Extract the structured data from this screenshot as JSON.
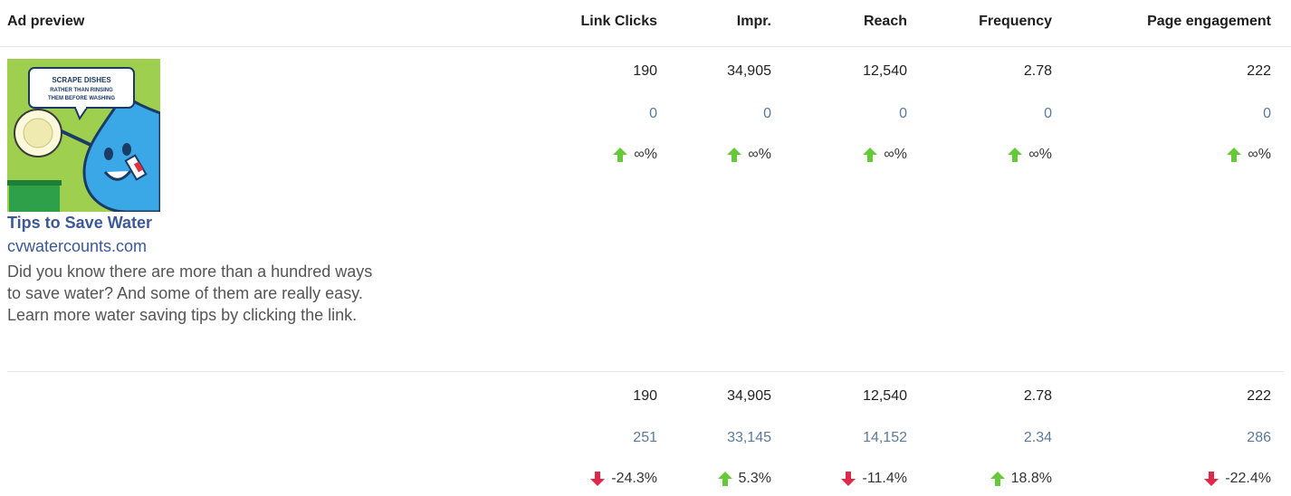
{
  "header": {
    "ad_preview": "Ad preview",
    "columns": [
      "Link Clicks",
      "Impr.",
      "Reach",
      "Frequency",
      "Page engagement"
    ]
  },
  "ad": {
    "image_caption": "SCRAPE DISHES RATHER THAN RINSING THEM BEFORE WASHING",
    "title": "Tips to Save Water",
    "domain": "cvwatercounts.com",
    "description": "Did you know there are more than a hundred ways to save water? And some of them are really easy. Learn more water saving tips by clicking the link."
  },
  "rows": [
    {
      "values": [
        "190",
        "34,905",
        "12,540",
        "2.78",
        "222"
      ],
      "compare": [
        "0",
        "0",
        "0",
        "0",
        "0"
      ],
      "changes": [
        "∞%",
        "∞%",
        "∞%",
        "∞%",
        "∞%"
      ],
      "directions": [
        "up",
        "up",
        "up",
        "up",
        "up"
      ]
    },
    {
      "values": [
        "190",
        "34,905",
        "12,540",
        "2.78",
        "222"
      ],
      "compare": [
        "251",
        "33,145",
        "14,152",
        "2.34",
        "286"
      ],
      "changes": [
        "-24.3%",
        "5.3%",
        "-11.4%",
        "18.8%",
        "-22.4%"
      ],
      "directions": [
        "down",
        "up",
        "down",
        "up",
        "down"
      ]
    }
  ],
  "colors": {
    "up": "#66c93a",
    "down": "#e0284a",
    "link": "#3b5998",
    "compare": "#5b7a9a"
  }
}
